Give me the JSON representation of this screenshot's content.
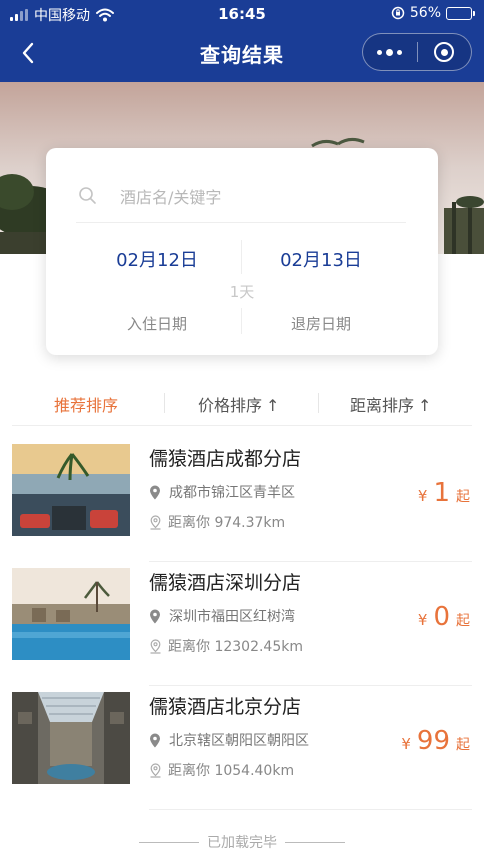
{
  "status_bar": {
    "carrier": "中国移动",
    "time": "16:45",
    "battery": "56%",
    "battery_level": 0.56
  },
  "nav": {
    "title": "查询结果"
  },
  "search": {
    "placeholder": "酒店名/关键字",
    "checkin_date": "02月12日",
    "checkout_date": "02月13日",
    "nights": "1天",
    "checkin_label": "入住日期",
    "checkout_label": "退房日期"
  },
  "sort": {
    "recommended": "推荐排序",
    "price": "价格排序",
    "distance": "距离排序",
    "arrow": "↑",
    "active_color": "#e8733b"
  },
  "hotels": [
    {
      "name": "儒猿酒店成都分店",
      "address": "成都市锦江区青羊区",
      "distance": "距离你 974.37km",
      "currency": "¥",
      "price": "1",
      "price_suffix": "起"
    },
    {
      "name": "儒猿酒店深圳分店",
      "address": "深圳市福田区红树湾",
      "distance": "距离你 12302.45km",
      "currency": "¥",
      "price": "0",
      "price_suffix": "起"
    },
    {
      "name": "儒猿酒店北京分店",
      "address": "北京辖区朝阳区朝阳区",
      "distance": "距离你 1054.40km",
      "currency": "¥",
      "price": "99",
      "price_suffix": "起"
    }
  ],
  "footer": {
    "text": "已加载完毕"
  },
  "colors": {
    "brand": "#1a3d96",
    "accent": "#e8733b"
  }
}
